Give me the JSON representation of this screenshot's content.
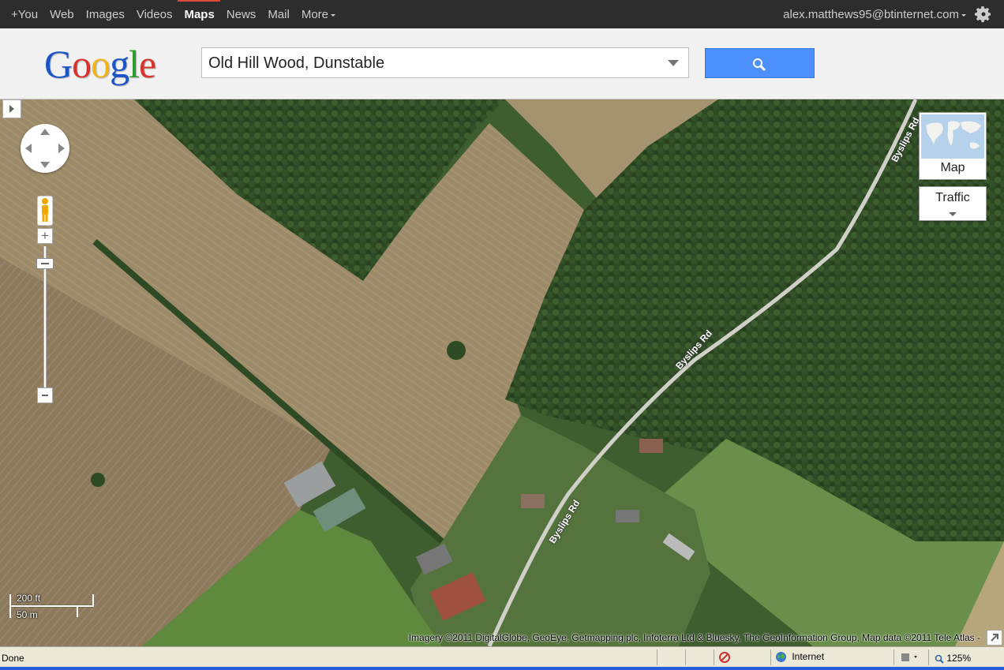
{
  "gbar": {
    "nav": [
      {
        "label": "+You"
      },
      {
        "label": "Web"
      },
      {
        "label": "Images"
      },
      {
        "label": "Videos"
      },
      {
        "label": "Maps",
        "active": true
      },
      {
        "label": "News"
      },
      {
        "label": "Mail"
      },
      {
        "label": "More"
      }
    ],
    "account": "alex.matthews95@btinternet.com"
  },
  "logo": {
    "letters": [
      "G",
      "o",
      "o",
      "g",
      "l",
      "e"
    ],
    "colors": [
      "#1a55c7",
      "#d6342c",
      "#f0b419",
      "#1a55c7",
      "#2c9a2f",
      "#d6342c"
    ]
  },
  "search": {
    "value": "Old Hill Wood, Dunstable"
  },
  "map": {
    "type_control": "Map",
    "traffic_control": "Traffic",
    "scale": {
      "ft": "200 ft",
      "m": "50 m"
    },
    "copyright": "Imagery ©2011 DigitalGlobe, GeoEye, Getmapping plc, Infoterra Ltd & Bluesky, The GeoInformation Group, Map data ©2011 Tele Atlas -",
    "road_labels": [
      "Byslips Rd",
      "Byslips Rd",
      "Byslips Rd"
    ]
  },
  "status": {
    "text": "Done",
    "zone": "Internet",
    "zoom": "125%"
  },
  "colors": {
    "accent": "#4d90fe",
    "bar": "#2d2d2d",
    "active": "#dd4b39"
  }
}
